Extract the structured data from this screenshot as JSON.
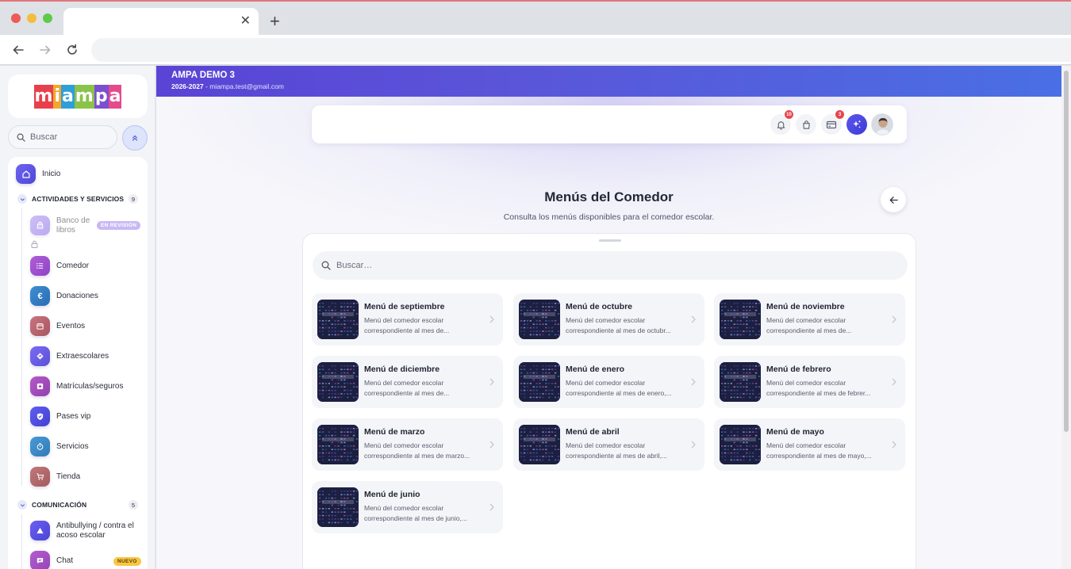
{
  "browser": {
    "tab_title": "",
    "close_glyph": "✕",
    "new_tab_glyph": "+",
    "address": ""
  },
  "sidebar": {
    "logo_letters": [
      "m",
      "i",
      "a",
      "m",
      "p",
      "a"
    ],
    "logo_colors": [
      "#e8404b",
      "#f2a72f",
      "#2e9fd9",
      "#8bc34a",
      "#7a4fd0",
      "#e54a8d"
    ],
    "search_placeholder": "Buscar",
    "home_label": "Inicio",
    "sections": [
      {
        "title": "ACTIVIDADES Y SERVICIOS",
        "count": "9",
        "items": [
          {
            "label": "Banco de libros",
            "icon": "book-bag-icon",
            "badge": "EN REVISIÓN",
            "locked": true
          },
          {
            "label": "Comedor",
            "icon": "list-icon"
          },
          {
            "label": "Donaciones",
            "icon": "euro-icon"
          },
          {
            "label": "Eventos",
            "icon": "calendar-icon"
          },
          {
            "label": "Extraescolares",
            "icon": "diamond-arrow-icon"
          },
          {
            "label": "Matrículas/seguros",
            "icon": "plus-square-icon"
          },
          {
            "label": "Pases vip",
            "icon": "shield-check-icon"
          },
          {
            "label": "Servicios",
            "icon": "timer-icon"
          },
          {
            "label": "Tienda",
            "icon": "cart-icon"
          }
        ]
      },
      {
        "title": "COMUNICACIÓN",
        "count": "5",
        "items": [
          {
            "label": "Antibullying / contra el acoso escolar",
            "icon": "triangle-icon"
          },
          {
            "label": "Chat",
            "icon": "chat-icon",
            "badge": "NUEVO"
          }
        ]
      }
    ]
  },
  "header": {
    "org_name": "AMPA DEMO 3",
    "year": "2026-2027",
    "email_separator": " - ",
    "email": "miampa.test@gmail.com",
    "notifications_count": "10",
    "cart_count": "",
    "payments_count": "3"
  },
  "page": {
    "title": "Menús del Comedor",
    "subtitle": "Consulta los menús disponibles para el comedor escolar.",
    "search_placeholder": "Buscar…"
  },
  "menus": [
    {
      "title": "Menú de septiembre",
      "line1": "Menú del comedor escolar",
      "line2": "correspondiente al mes de..."
    },
    {
      "title": "Menú de octubre",
      "line1": "Menú del comedor escolar",
      "line2": "correspondiente al mes de octubr..."
    },
    {
      "title": "Menú de noviembre",
      "line1": "Menú del comedor escolar",
      "line2": "correspondiente al mes de..."
    },
    {
      "title": "Menú de diciembre",
      "line1": "Menú del comedor escolar",
      "line2": "correspondiente al mes de..."
    },
    {
      "title": "Menú de enero",
      "line1": "Menú del comedor escolar",
      "line2": "correspondiente al mes de enero,..."
    },
    {
      "title": "Menú de febrero",
      "line1": "Menú del comedor escolar",
      "line2": "correspondiente al mes de febrer..."
    },
    {
      "title": "Menú de marzo",
      "line1": "Menú del comedor escolar",
      "line2": "correspondiente al mes de marzo..."
    },
    {
      "title": "Menú de abril",
      "line1": "Menú del comedor escolar",
      "line2": "correspondiente al mes de abril,..."
    },
    {
      "title": "Menú de mayo",
      "line1": "Menú del comedor escolar",
      "line2": "correspondiente al mes de mayo,..."
    },
    {
      "title": "Menú de junio",
      "line1": "Menú del comedor escolar",
      "line2": "correspondiente al mes de junio,..."
    }
  ],
  "colors": {
    "accent": "#5a4fd8",
    "topbar_start": "#5944d5",
    "topbar_end": "#4a6fe5",
    "badge_review_bg": "#c9b8f5",
    "badge_new_bg": "#f9c644",
    "notif_red": "#e5474d"
  }
}
